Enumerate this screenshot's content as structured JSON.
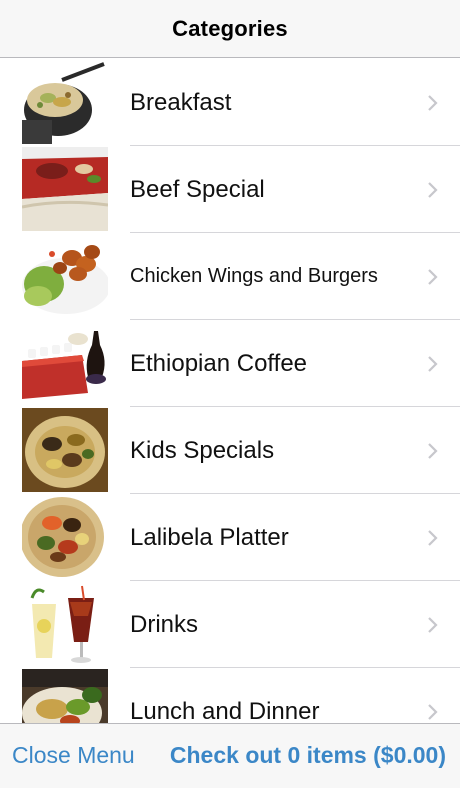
{
  "navbar": {
    "title": "Categories"
  },
  "categories": [
    {
      "label": "Breakfast",
      "icon": "breakfast-photo"
    },
    {
      "label": "Beef Special",
      "icon": "beef-special-photo"
    },
    {
      "label": "Chicken Wings and Burgers",
      "icon": "chicken-wings-photo"
    },
    {
      "label": "Ethiopian Coffee",
      "icon": "ethiopian-coffee-photo"
    },
    {
      "label": "Kids Specials",
      "icon": "kids-specials-photo"
    },
    {
      "label": "Lalibela Platter",
      "icon": "lalibela-platter-photo"
    },
    {
      "label": "Drinks",
      "icon": "drinks-photo"
    },
    {
      "label": "Lunch and Dinner",
      "icon": "lunch-dinner-photo"
    }
  ],
  "toolbar": {
    "close_label": "Close Menu",
    "checkout_label": "Check out 0 items ($0.00)"
  },
  "colors": {
    "accent": "#3b87c7",
    "bar_background": "#f7f7f7",
    "separator": "#d6d6da",
    "chevron": "#c7c7cc"
  }
}
